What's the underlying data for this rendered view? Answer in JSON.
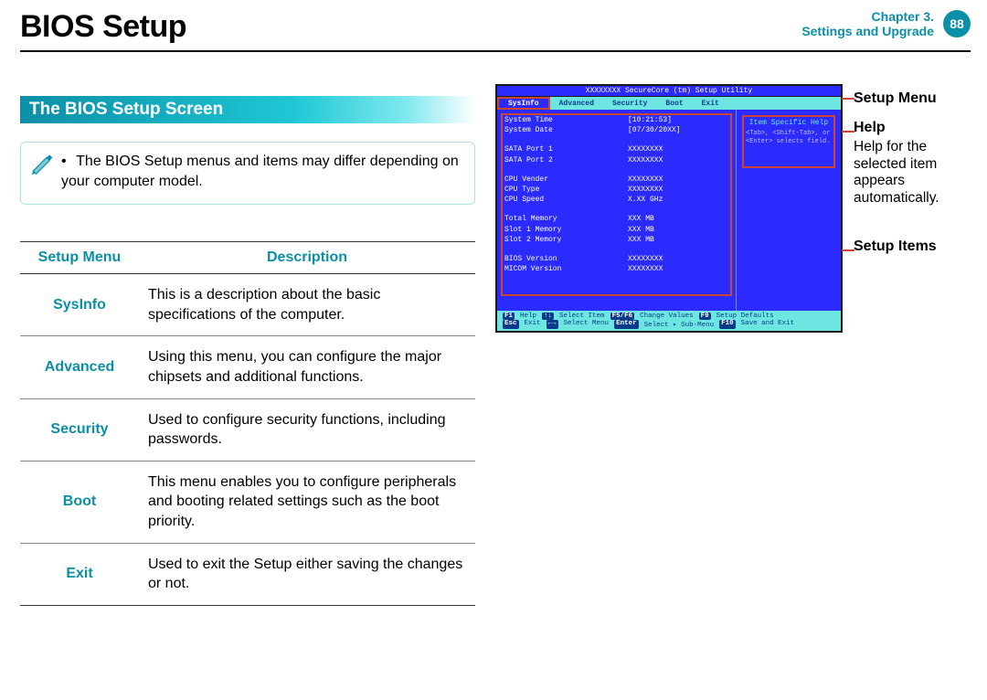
{
  "header": {
    "title": "BIOS Setup",
    "chapter_line1": "Chapter 3.",
    "chapter_line2": "Settings and Upgrade",
    "page_number": "88"
  },
  "section_title": "The BIOS Setup Screen",
  "note": {
    "text_line": "The BIOS Setup menus and items may differ depending on your computer model."
  },
  "menu_table": {
    "col1_header": "Setup Menu",
    "col2_header": "Description",
    "rows": [
      {
        "menu": "SysInfo",
        "desc": "This is a description about the basic specifications of the computer."
      },
      {
        "menu": "Advanced",
        "desc": "Using this menu, you can configure the major chipsets and additional functions."
      },
      {
        "menu": "Security",
        "desc": "Used to configure security functions, including passwords."
      },
      {
        "menu": "Boot",
        "desc": "This menu enables you to configure peripherals and booting related settings such as the boot priority."
      },
      {
        "menu": "Exit",
        "desc": "Used to exit the Setup either saving the changes or not."
      }
    ]
  },
  "callouts": {
    "setup_menu": "Setup Menu",
    "help_title": "Help",
    "help_body": "Help for the selected item appears automatically.",
    "setup_items": "Setup Items"
  },
  "bios": {
    "title": "XXXXXXXX SecureCore (tm) Setup Utility",
    "menus": [
      "SysInfo",
      "Advanced",
      "Security",
      "Boot",
      "Exit"
    ],
    "active_menu_index": 0,
    "help_title": "Item Specific Help",
    "help_body": "<Tab>, <Shift-Tab>, or <Enter> selects field.",
    "rows": [
      {
        "k": "System Time",
        "v": "[10:21:53]"
      },
      {
        "k": "System Date",
        "v": "[07/30/20XX]"
      },
      {
        "k": "",
        "v": ""
      },
      {
        "k": "SATA Port 1",
        "v": "XXXXXXXX"
      },
      {
        "k": "SATA Port 2",
        "v": "XXXXXXXX"
      },
      {
        "k": "",
        "v": ""
      },
      {
        "k": "CPU Vender",
        "v": "XXXXXXXX"
      },
      {
        "k": "CPU Type",
        "v": "XXXXXXXX"
      },
      {
        "k": "CPU Speed",
        "v": "X.XX GHz"
      },
      {
        "k": "",
        "v": ""
      },
      {
        "k": "Total Memory",
        "v": "XXX MB"
      },
      {
        "k": "  Slot 1 Memory",
        "v": "XXX MB"
      },
      {
        "k": "  Slot 2 Memory",
        "v": "XXX MB"
      },
      {
        "k": "",
        "v": ""
      },
      {
        "k": "BIOS Version",
        "v": "XXXXXXXX"
      },
      {
        "k": "MICOM Version",
        "v": "XXXXXXXX"
      }
    ],
    "footer": {
      "line1": [
        {
          "k": "F1",
          "t": "Help"
        },
        {
          "k": "↑↓",
          "t": "Select Item"
        },
        {
          "k": "F5/F6",
          "t": "Change Values"
        },
        {
          "k": "F9",
          "t": "Setup Defaults"
        }
      ],
      "line2": [
        {
          "k": "Esc",
          "t": "Exit"
        },
        {
          "k": "←→",
          "t": "Select Menu"
        },
        {
          "k": "Enter",
          "t": "Select ▸ Sub-Menu"
        },
        {
          "k": "F10",
          "t": "Save and Exit"
        }
      ]
    }
  }
}
